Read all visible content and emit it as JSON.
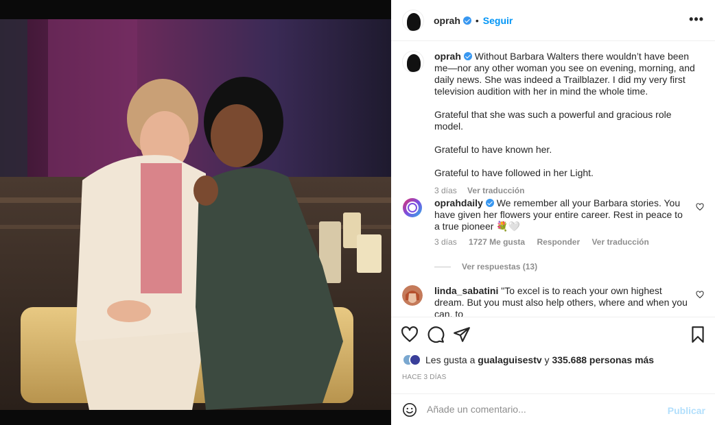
{
  "post": {
    "username": "oprah",
    "follow_label": "Seguir",
    "separator": "•",
    "more_label": "•••"
  },
  "caption": {
    "username": "oprah",
    "paragraphs": [
      "Without Barbara Walters there wouldn’t have been me—nor any other woman you see on evening, morning, and daily news. She was indeed a Trailblazer. I did my very first television audition with her in mind the whole time.",
      "Grateful that she was such a powerful and gracious role model.",
      "Grateful to have known her.",
      "Grateful to have followed in her Light."
    ],
    "time": "3 días",
    "translate": "Ver traducción"
  },
  "comments": [
    {
      "username": "oprahdaily",
      "text": "We remember all your Barbara stories. You have given her flowers your entire career. Rest in peace to a true pioneer 💐🤍",
      "time": "3 días",
      "likes": "1727 Me gusta",
      "reply": "Responder",
      "translate": "Ver traducción"
    },
    {
      "username": "linda_sabatini",
      "text": "\"To excel is to reach your own highest dream. But you must also help others, where and when you can, to"
    }
  ],
  "view_replies": "Ver respuestas (13)",
  "likes": {
    "prefix": "Les gusta a",
    "user": "gualaguisestv",
    "conj": "y",
    "count": "335.688 personas más"
  },
  "posted": "HACE 3 DÍAS",
  "add_comment": {
    "placeholder": "Añade un comentario...",
    "publish": "Publicar"
  },
  "colors": {
    "link_blue": "#0095f6",
    "verified_blue": "#3897f0",
    "publish_disabled": "#b2dffc",
    "muted": "#8e8e8e"
  }
}
